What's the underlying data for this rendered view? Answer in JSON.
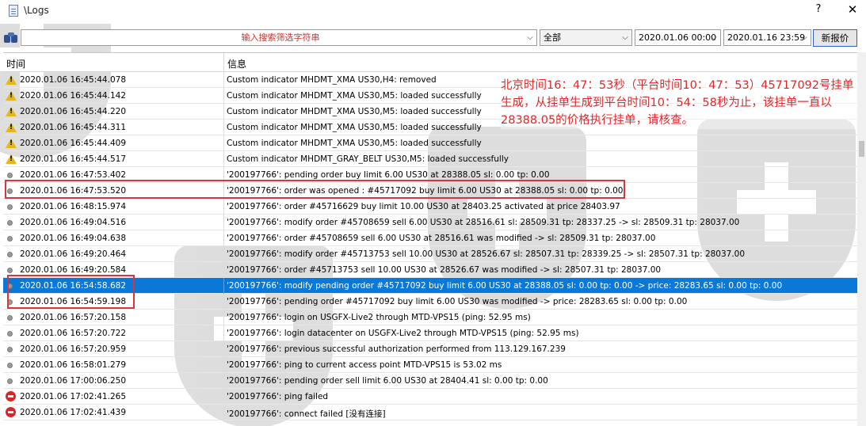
{
  "window": {
    "title": "\\Logs",
    "help_label": "?",
    "close_label": "✕"
  },
  "toolbar": {
    "search_placeholder": "输入搜索筛选字符串",
    "filter_value": "全部",
    "date_from": "2020.01.06 00:00",
    "date_to": "2020.01.16 23:59",
    "new_button_label": "新报价"
  },
  "table": {
    "columns": [
      "时间",
      "信息"
    ],
    "rows": [
      {
        "icon": "warning-icon",
        "time": "2020.01.06 16:45:44.078",
        "message": "Custom indicator MHDMT_XMA US30,H4: removed"
      },
      {
        "icon": "warning-icon",
        "time": "2020.01.06 16:45:44.142",
        "message": "Custom indicator MHDMT_XMA US30,M5: loaded successfully"
      },
      {
        "icon": "warning-icon",
        "time": "2020.01.06 16:45:44.220",
        "message": "Custom indicator MHDMT_XMA US30,M5: loaded successfully"
      },
      {
        "icon": "warning-icon",
        "time": "2020.01.06 16:45:44.311",
        "message": "Custom indicator MHDMT_XMA US30,M5: loaded successfully"
      },
      {
        "icon": "warning-icon",
        "time": "2020.01.06 16:45:44.409",
        "message": "Custom indicator MHDMT_XMA US30,M5: loaded successfully"
      },
      {
        "icon": "warning-icon",
        "time": "2020.01.06 16:45:44.517",
        "message": "Custom indicator MHDMT_GRAY_BELT US30,M5: loaded successfully"
      },
      {
        "icon": "info-dot-icon",
        "time": "2020.01.06 16:47:53.402",
        "message": "'200197766': pending order buy limit 6.00 US30 at 28388.05 sl: 0.00 tp: 0.00"
      },
      {
        "icon": "info-dot-icon",
        "time": "2020.01.06 16:47:53.520",
        "message": "'200197766': order was opened : #45717092 buy limit 6.00 US30 at 28388.05 sl: 0.00 tp: 0.00"
      },
      {
        "icon": "info-dot-icon",
        "time": "2020.01.06 16:48:15.974",
        "message": "'200197766': order #45716629 buy limit 10.00 US30 at 28403.25 activated at price 28403.97"
      },
      {
        "icon": "info-dot-icon",
        "time": "2020.01.06 16:49:04.516",
        "message": "'200197766': modify order #45708659 sell 6.00 US30 at 28516.61 sl: 28509.31 tp: 28337.25 -> sl: 28509.31 tp: 28037.00"
      },
      {
        "icon": "info-dot-icon",
        "time": "2020.01.06 16:49:04.638",
        "message": "'200197766': order #45708659 sell 6.00 US30 at 28516.61 was modified -> sl: 28509.31 tp: 28037.00"
      },
      {
        "icon": "info-dot-icon",
        "time": "2020.01.06 16:49:20.464",
        "message": "'200197766': modify order #45713753 sell 10.00 US30 at 28526.67 sl: 28507.31 tp: 28339.25 -> sl: 28507.31 tp: 28037.00"
      },
      {
        "icon": "info-dot-icon",
        "time": "2020.01.06 16:49:20.584",
        "message": "'200197766': order #45713753 sell 10.00 US30 at 28526.67 was modified -> sl: 28507.31 tp: 28037.00"
      },
      {
        "icon": "info-dot-icon",
        "time": "2020.01.06 16:54:58.682",
        "message": "'200197766': modify pending order #45717092 buy limit 6.00 US30 at 28388.05 sl: 0.00 tp: 0.00 -> price: 28283.65 sl: 0.00 tp: 0.00",
        "selected": true
      },
      {
        "icon": "info-dot-icon",
        "time": "2020.01.06 16:54:59.198",
        "message": "'200197766': pending order #45717092 buy limit 6.00 US30 was modified -> price: 28283.65 sl: 0.00 tp: 0.00"
      },
      {
        "icon": "info-dot-icon",
        "time": "2020.01.06 16:57:20.158",
        "message": "'200197766': login on USGFX-Live2 through MTD-VPS15 (ping: 52.95 ms)"
      },
      {
        "icon": "info-dot-icon",
        "time": "2020.01.06 16:57:20.722",
        "message": "'200197766': login datacenter on USGFX-Live2 through MTD-VPS15 (ping: 52.95 ms)"
      },
      {
        "icon": "info-dot-icon",
        "time": "2020.01.06 16:57:20.959",
        "message": "'200197766': previous successful authorization performed from 113.129.167.239"
      },
      {
        "icon": "info-dot-icon",
        "time": "2020.01.06 16:58:01.279",
        "message": "'200197766': ping to current access point MTD-VPS15 is 53.02 ms"
      },
      {
        "icon": "info-dot-icon",
        "time": "2020.01.06 17:00:06.250",
        "message": "'200197766': pending order sell limit 6.00 US30 at 28404.41 sl: 0.00 tp: 0.00"
      },
      {
        "icon": "error-icon",
        "time": "2020.01.06 17:02:41.265",
        "message": "'200197766': ping failed"
      },
      {
        "icon": "error-icon",
        "time": "2020.01.06 17:02:41.439",
        "message": "'200197766': connect failed [没有连接]"
      }
    ]
  },
  "annotation": {
    "text": "北京时间16：47：53秒（平台时间10：47：53）45717092号挂单生成，从挂单生成到平台时间10：54：58秒为止，该挂单一直以28388.05的价格执行挂单，请核查。",
    "color": "#e0282a"
  },
  "colors": {
    "selection": "#0a78d7",
    "warning": "#e3b917",
    "error": "#d6262a",
    "highlight_box": "#d9363a"
  }
}
